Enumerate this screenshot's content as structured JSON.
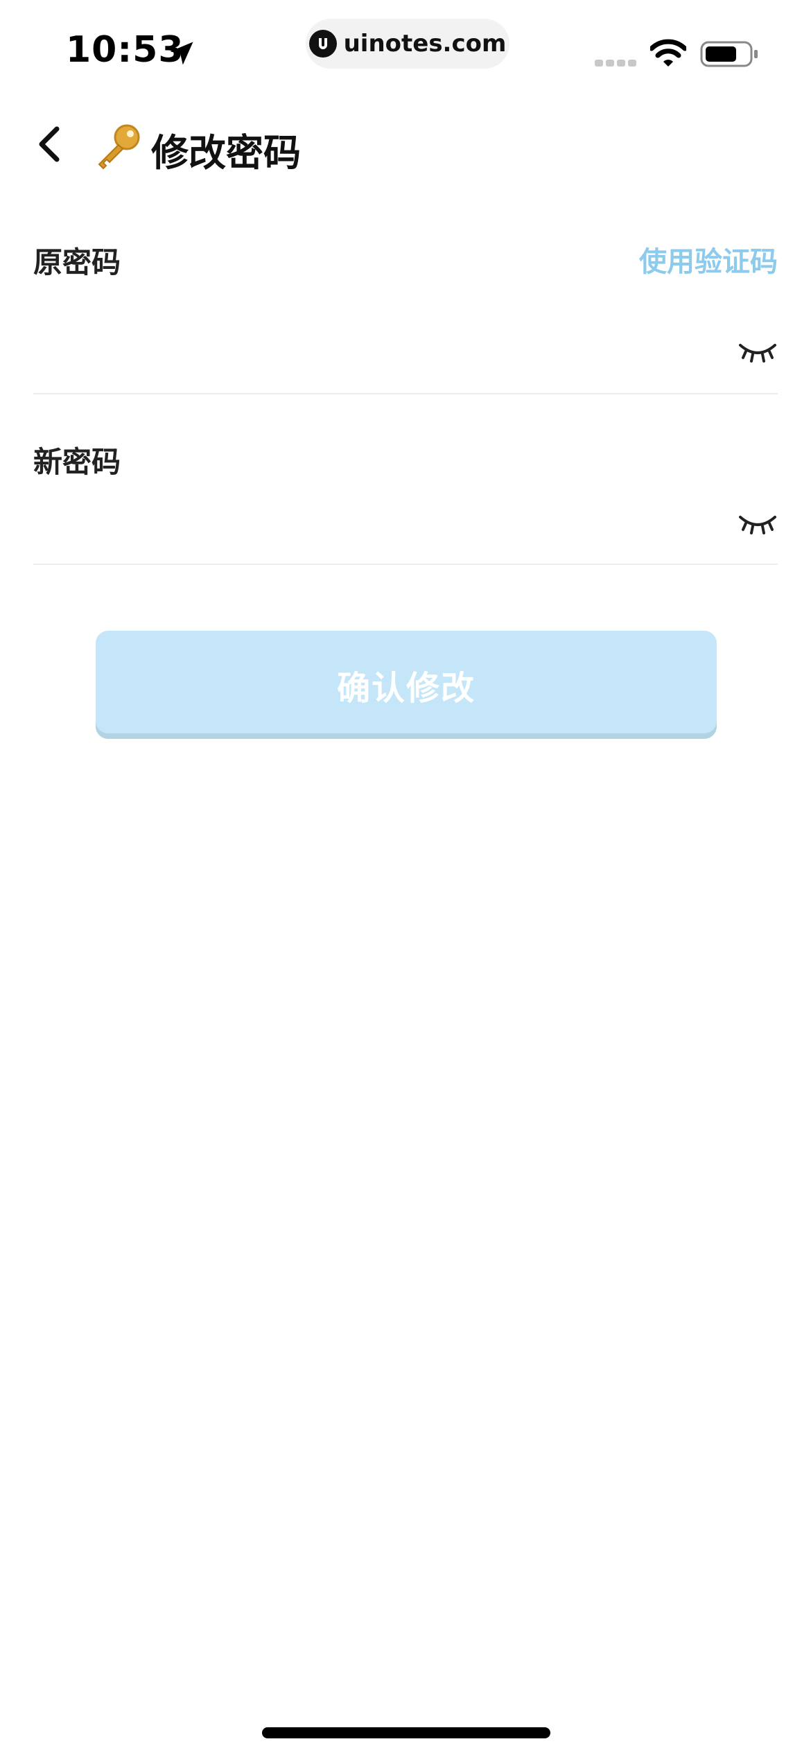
{
  "status_bar": {
    "time": "10:53",
    "url": "uinotes.com",
    "icons": [
      "location-arrow-icon",
      "site-logo-icon",
      "cellular-signal-icon",
      "wifi-icon",
      "battery-icon"
    ]
  },
  "header": {
    "title": "修改密码",
    "back_icon": "chevron-left-icon",
    "title_icon": "key-icon"
  },
  "form": {
    "old_password": {
      "label": "原密码",
      "alt_link": "使用验证码",
      "value": "",
      "toggle_icon": "eye-closed-icon"
    },
    "new_password": {
      "label": "新密码",
      "value": "",
      "toggle_icon": "eye-closed-icon"
    },
    "submit_label": "确认修改"
  },
  "colors": {
    "link": "#8ccbeb",
    "button_disabled": "#c4e6f8",
    "divider": "#ececec"
  }
}
